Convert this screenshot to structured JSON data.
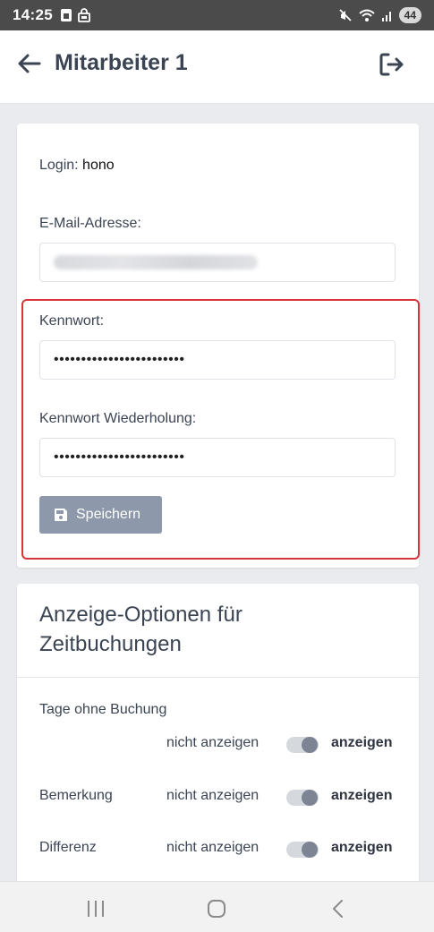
{
  "status_bar": {
    "time": "14:25",
    "battery": "44",
    "icons": [
      "sim-icon",
      "lock-icon",
      "mute-icon",
      "wifi-icon",
      "signal-icon"
    ]
  },
  "header": {
    "title": "Mitarbeiter 1",
    "back_icon": "arrow-left-icon",
    "logout_icon": "logout-icon"
  },
  "account": {
    "login_label": "Login:",
    "login_value": "hono",
    "email_label": "E-Mail-Adresse:",
    "password_label": "Kennwort:",
    "password_value": "••••••••••••••••••••••••",
    "password_repeat_label": "Kennwort Wiederholung:",
    "password_repeat_value": "••••••••••••••••••••••••",
    "save_label": "Speichern",
    "highlight_color": "#d8333a"
  },
  "display_options": {
    "title": "Anzeige-Optionen für Zeitbuchungen",
    "off_label": "nicht anzeigen",
    "on_label": "anzeigen",
    "rows": [
      {
        "label": "Tage ohne Buchung"
      },
      {
        "label": "Bemerkung"
      },
      {
        "label": "Differenz"
      }
    ]
  },
  "colors": {
    "button": "#8d98ab",
    "header_text": "#3b4453",
    "status_bar": "#4b4b4b"
  }
}
